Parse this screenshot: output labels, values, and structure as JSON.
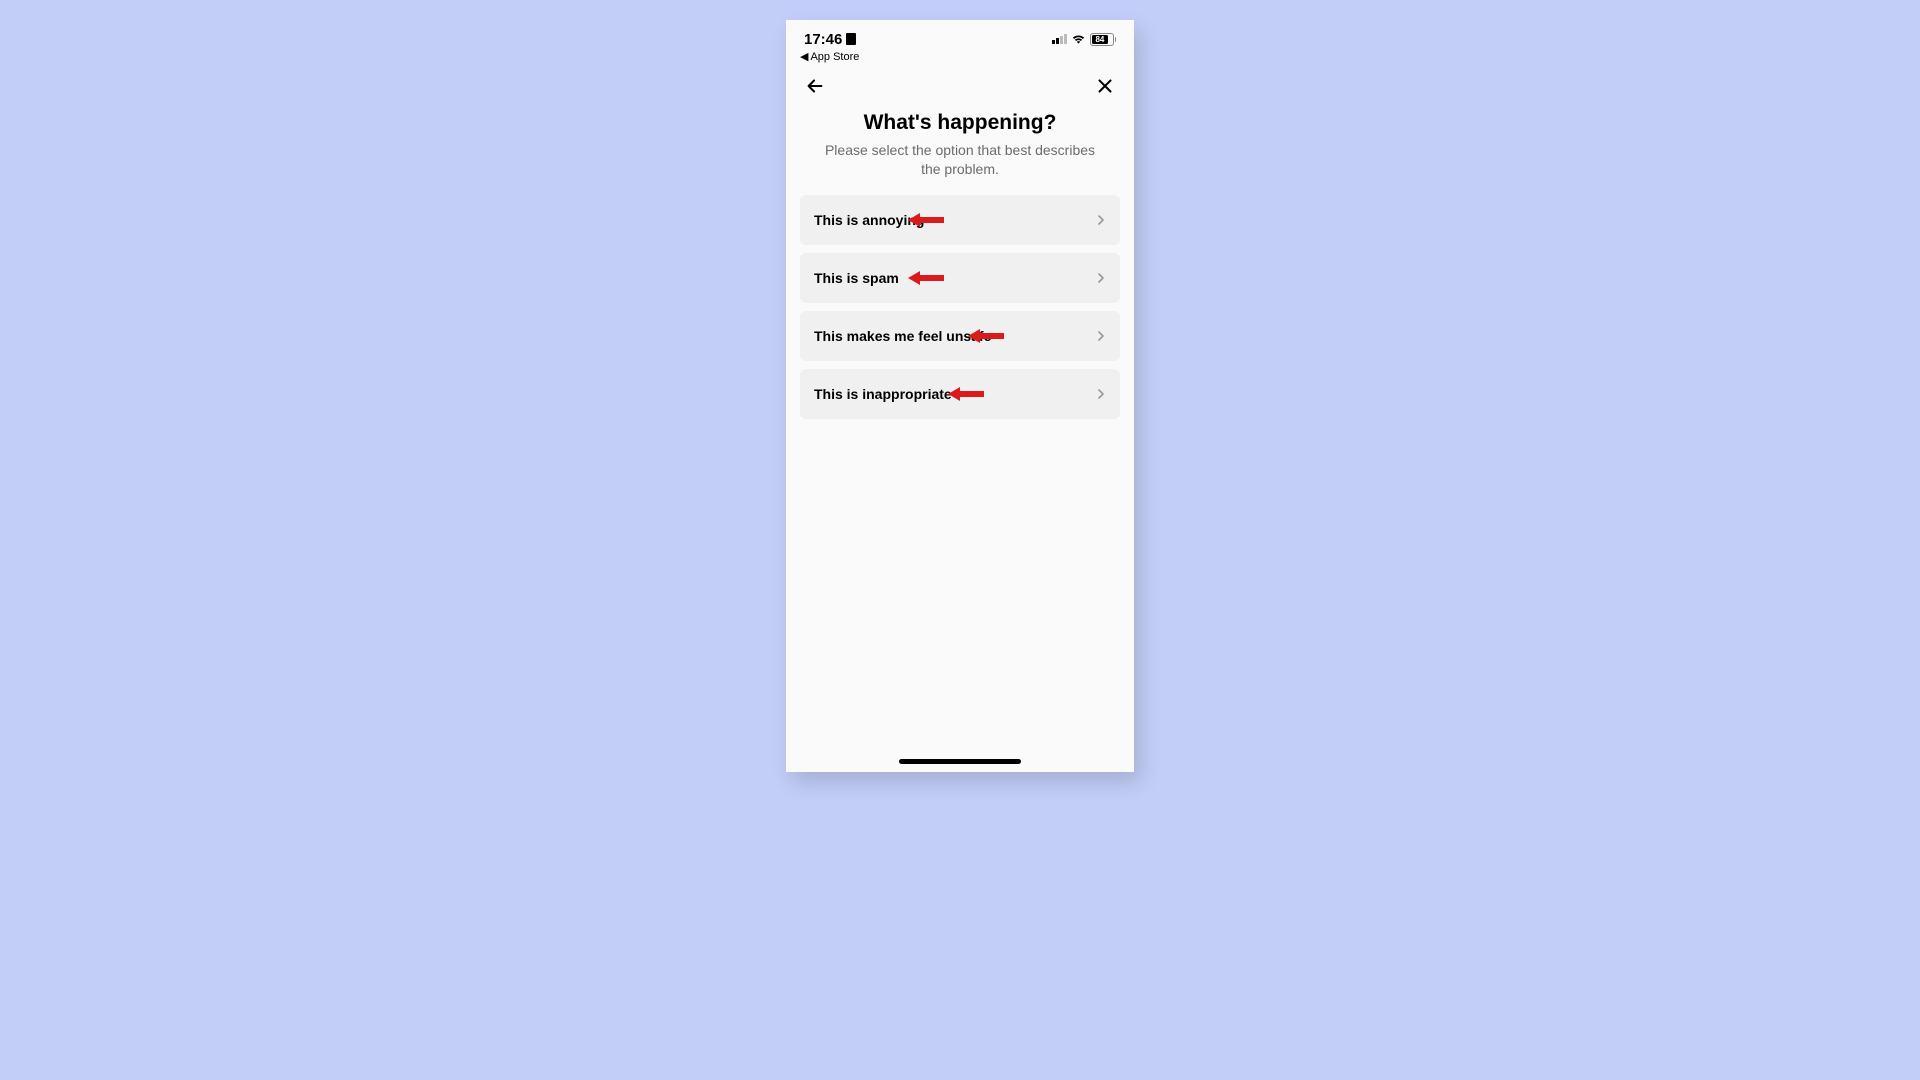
{
  "statusBar": {
    "time": "17:46",
    "battery": "84",
    "backLink": "App Store"
  },
  "header": {
    "title": "What's happening?",
    "subtitle": "Please select the option that best describes the problem."
  },
  "options": [
    {
      "label": "This is annoying"
    },
    {
      "label": "This is spam"
    },
    {
      "label": "This makes me feel unsafe"
    },
    {
      "label": "This is inappropriate"
    }
  ],
  "annotation": {
    "arrowColor": "#d91b1b"
  }
}
